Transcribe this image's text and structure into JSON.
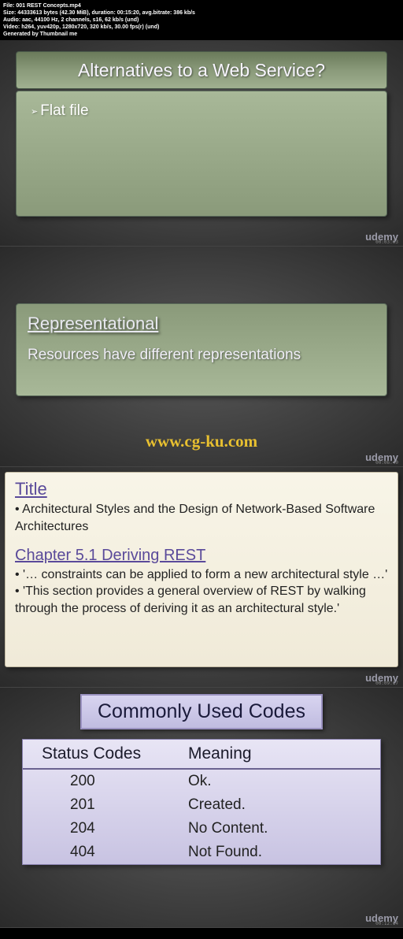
{
  "metadata": {
    "file": "File: 001 REST Concepts.mp4",
    "size": "Size: 44333613 bytes (42.30 MiB), duration: 00:15:20, avg.bitrate: 386 kb/s",
    "audio": "Audio: aac, 44100 Hz, 2 channels, s16, 62 kb/s (und)",
    "video": "Video: h264, yuv420p, 1280x720, 320 kb/s, 30.00 fps(r) (und)",
    "generated": "Generated by Thumbnail me"
  },
  "panel1": {
    "title": "Alternatives to a Web Service?",
    "bullet": "Flat file",
    "timestamp": "00:03:03"
  },
  "panel2": {
    "heading": "Representational",
    "text": "Resources have different representations",
    "watermark": "www.cg-ku.com",
    "timestamp": "00:06:40"
  },
  "panel3": {
    "title_heading": "Title",
    "title_text": "• Architectural Styles and the Design of Network-Based Software Architectures",
    "chapter_heading": "Chapter 5.1 Deriving REST",
    "chapter_text1": "• '… constraints can be applied to form a new architectural style …'",
    "chapter_text2": "• 'This section provides a general overview of REST by walking through the process of deriving it as an architectural style.'",
    "timestamp": "00:09:17"
  },
  "panel4": {
    "title": "Commonly Used Codes",
    "header_col1": "Status Codes",
    "header_col2": "Meaning",
    "rows": [
      {
        "code": "200",
        "meaning": "Ok."
      },
      {
        "code": "201",
        "meaning": "Created."
      },
      {
        "code": "204",
        "meaning": "No Content."
      },
      {
        "code": "404",
        "meaning": "Not Found."
      }
    ],
    "timestamp": "00:12:14"
  },
  "brand": "udemy"
}
